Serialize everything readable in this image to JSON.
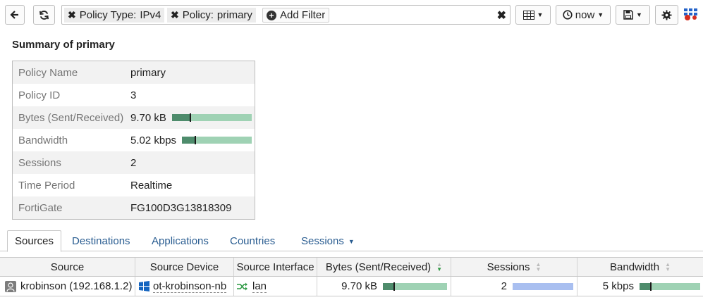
{
  "toolbar": {
    "back_icon": "back-arrow-icon",
    "refresh_icon": "refresh-icon",
    "filters": [
      {
        "key": "Policy Type:",
        "value": "IPv4"
      },
      {
        "key": "Policy:",
        "value": "primary"
      }
    ],
    "add_filter_label": "Add Filter",
    "time_label": "now",
    "icons": [
      "grid-view-icon",
      "clock-icon",
      "save-icon",
      "gear-icon",
      "fortinet-logo-icon"
    ]
  },
  "summary": {
    "title": "Summary of primary",
    "rows": [
      {
        "label": "Policy Name",
        "value": "primary"
      },
      {
        "label": "Policy ID",
        "value": "3"
      },
      {
        "label": "Bytes (Sent/Received)",
        "value": "9.70 kB",
        "bar": {
          "received_fraction": 0.23,
          "marker": 0.22
        }
      },
      {
        "label": "Bandwidth",
        "value": "5.02 kbps",
        "bar": {
          "received_fraction": 0.19,
          "marker": 0.18
        }
      },
      {
        "label": "Sessions",
        "value": "2"
      },
      {
        "label": "Time Period",
        "value": "Realtime"
      },
      {
        "label": "FortiGate",
        "value": "FG100D3G13818309"
      }
    ]
  },
  "tabs": [
    {
      "label": "Sources",
      "active": true
    },
    {
      "label": "Destinations",
      "active": false
    },
    {
      "label": "Applications",
      "active": false
    },
    {
      "label": "Countries",
      "active": false
    },
    {
      "label": "Sessions",
      "active": false,
      "dropdown": true
    }
  ],
  "table": {
    "columns": [
      "Source",
      "Source Device",
      "Source Interface",
      "Bytes (Sent/Received)",
      "Sessions",
      "Bandwidth"
    ],
    "sorted_column": "Bytes (Sent/Received)",
    "rows": [
      {
        "source": "krobinson (192.168.1.2)",
        "device": "ot-krobinson-nb",
        "interface": "lan",
        "bytes": "9.70 kB",
        "bytes_bar": {
          "received_fraction": 0.18,
          "marker": 0.17
        },
        "sessions": "2",
        "sessions_fraction": 1.0,
        "bandwidth": "5 kbps",
        "bandwidth_bar": {
          "received_fraction": 0.18,
          "marker": 0.17
        }
      }
    ]
  },
  "colors": {
    "link": "#2a5d91",
    "bar_light": "#9fd2b4",
    "bar_dark": "#4e8c6c",
    "sessions_bar": "#a9bff0",
    "sort_active": "#2f9a45"
  }
}
